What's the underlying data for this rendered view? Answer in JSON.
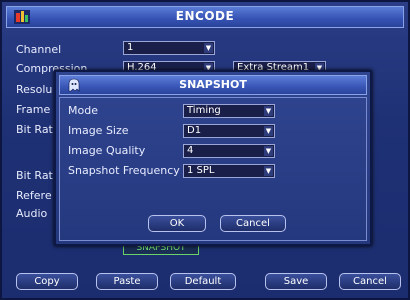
{
  "window": {
    "title": "ENCODE"
  },
  "form": {
    "channel_label": "Channel",
    "channel_value": "1",
    "compression_label": "Compression",
    "compression_value": "H.264",
    "extra_stream_value": "Extra Stream1",
    "resolution_label": "Resolu",
    "frame_label": "Frame",
    "bitrate_label": "Bit Rat",
    "bitrate2_label": "Bit Rat",
    "reference_label": "Refere",
    "audio_label": "Audio"
  },
  "snapshot_button": {
    "label": "SNAPSHOT"
  },
  "footer": {
    "copy": "Copy",
    "paste": "Paste",
    "default": "Default",
    "save": "Save",
    "cancel": "Cancel"
  },
  "dialog": {
    "title": "SNAPSHOT",
    "mode_label": "Mode",
    "mode_value": "Timing",
    "image_size_label": "Image Size",
    "image_size_value": "D1",
    "image_quality_label": "Image Quality",
    "image_quality_value": "4",
    "frequency_label": "Snapshot Frequency",
    "frequency_value": "1 SPL",
    "ok": "OK",
    "cancel": "Cancel"
  },
  "icons": {
    "logo": "app-logo-icon",
    "dropdown": "chevron-down-icon",
    "dialog_logo": "ghost-logo-icon"
  }
}
